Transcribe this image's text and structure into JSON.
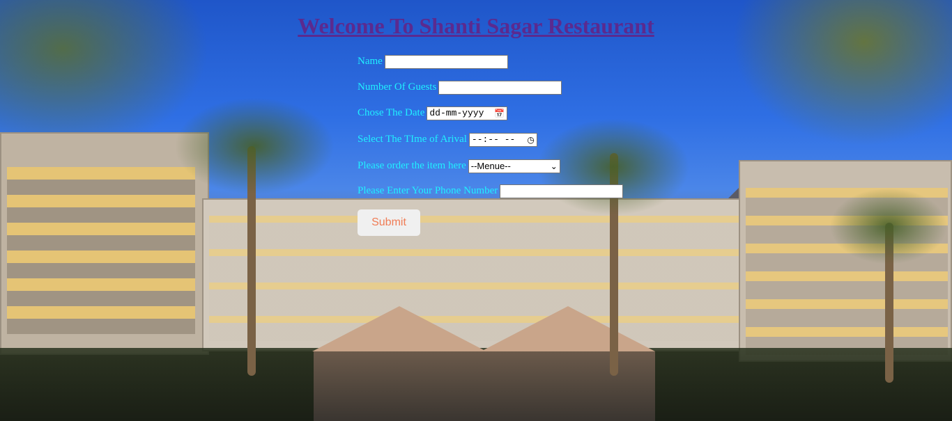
{
  "page": {
    "title": "Welcome To Shanti Sagar Restaurant"
  },
  "form": {
    "name_label": "Name",
    "name_value": "",
    "guests_label": "Number Of Guests",
    "guests_value": "",
    "date_label": "Chose The Date",
    "date_placeholder": "dd-mm-yyyy",
    "time_label": "Select The TIme of Arival",
    "time_placeholder": "--:-- --",
    "order_label": "Please order the item here",
    "order_selected": "--Menue--",
    "phone_label": "Please Enter Your Phone Number",
    "phone_value": "",
    "submit_label": "Submit"
  },
  "icons": {
    "date": "calendar-icon",
    "time": "clock-icon",
    "select": "chevron-down-icon"
  },
  "colors": {
    "title": "#5b2a8f",
    "label": "#20f0ff",
    "submit_text": "#f07c55",
    "submit_bg": "#f0f0f0"
  }
}
